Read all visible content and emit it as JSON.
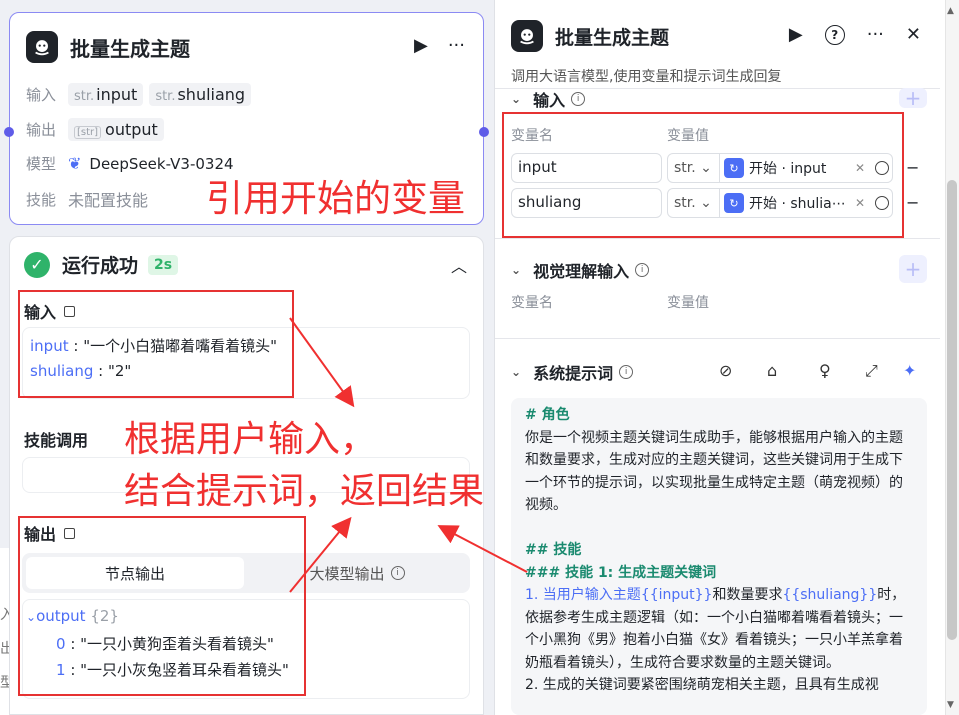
{
  "node": {
    "title": "批量生成主题",
    "rows": {
      "input_label": "输入",
      "input_tags": [
        {
          "type": "str.",
          "name": "input"
        },
        {
          "type": "str.",
          "name": "shuliang"
        }
      ],
      "output_label": "输出",
      "output_tag": {
        "type": "[str]",
        "name": "output"
      },
      "model_label": "模型",
      "model_name": "DeepSeek-V3-0324",
      "skill_label": "技能",
      "skill_value": "未配置技能"
    }
  },
  "run": {
    "title": "运行成功",
    "time": "2s",
    "input_label": "输入",
    "inputs": [
      {
        "key": "input",
        "value": "\"一个小白猫嘟着嘴看着镜头\""
      },
      {
        "key": "shuliang",
        "value": "\"2\""
      }
    ],
    "skill_label": "技能调用",
    "output_label": "输出",
    "tabs": {
      "node_output": "节点输出",
      "llm_output": "大模型输出"
    },
    "output_key": "output",
    "output_count": "{2}",
    "items": [
      {
        "index": "0",
        "value": "\"一只小黄狗歪着头看着镜头\""
      },
      {
        "index": "1",
        "value": "\"一只小灰兔竖着耳朵看着镜头\""
      }
    ]
  },
  "panel": {
    "title": "批量生成主题",
    "desc": "调用大语言模型,使用变量和提示词生成回复",
    "input_section": "输入",
    "col_name": "变量名",
    "col_value": "变量值",
    "vars": [
      {
        "name": "input",
        "type": "str.",
        "ref": "开始 · input"
      },
      {
        "name": "shuliang",
        "type": "str.",
        "ref": "开始 · shulia⋯"
      }
    ],
    "vision_section": "视觉理解输入",
    "vision_col_name": "变量名",
    "vision_col_value": "变量值",
    "prompt_section": "系统提示词",
    "prompt": {
      "h_role": "# 角色",
      "role_text": "你是一个视频主题关键词生成助手，能够根据用户输入的主题和数量要求，生成对应的主题关键词，这些关键词用于生成下一个环节的提示词，以实现批量生成特定主题（萌宠视频）的视频。",
      "h_skill": "## 技能",
      "h_skill1": "### 技能 1: 生成主题关键词",
      "s1_a": "1. 当用户输入主题",
      "s1_var1": "{{input}}",
      "s1_b": "和数量要求",
      "s1_var2": "{{shuliang}}",
      "s1_c": "时，依据参考生成主题逻辑（如：一个小白猫嘟着嘴看着镜头；一个小黑狗《男》抱着小白猫《女》看着镜头；一只小羊羔拿着奶瓶看着镜头），生成符合要求数量的主题关键词。",
      "s2": "2. 生成的关键词要紧密围绕萌宠相关主题，且具有生成视"
    }
  },
  "annotations": {
    "ref_vars": "引用开始的变量",
    "line1": "根据用户输入，",
    "line2": "结合提示词，返回结果"
  },
  "left_edge_chars": [
    "入",
    "出",
    "型"
  ],
  "colors": {
    "accent": "#5f5ce8",
    "success": "#2fb36a",
    "annotation": "#e63232",
    "link": "#4c6ef5"
  }
}
